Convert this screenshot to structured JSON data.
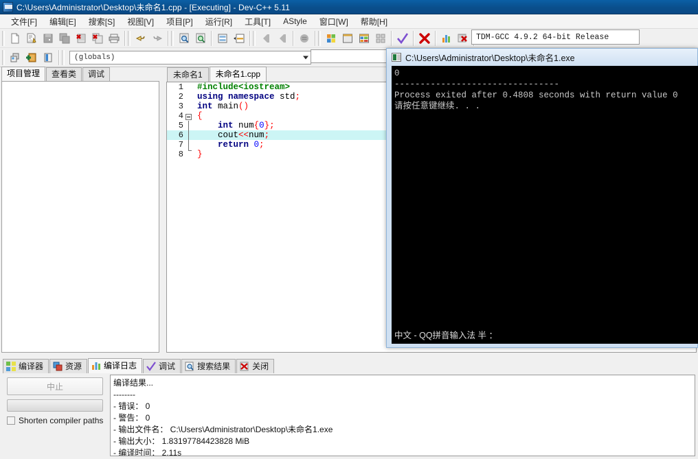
{
  "window": {
    "title": "C:\\Users\\Administrator\\Desktop\\未命名1.cpp - [Executing] - Dev-C++ 5.11",
    "icon": "devcpp-icon"
  },
  "menubar": {
    "items": [
      {
        "label": "文件[F]"
      },
      {
        "label": "编辑[E]"
      },
      {
        "label": "搜索[S]"
      },
      {
        "label": "视图[V]"
      },
      {
        "label": "项目[P]"
      },
      {
        "label": "运行[R]"
      },
      {
        "label": "工具[T]"
      },
      {
        "label": "AStyle"
      },
      {
        "label": "窗口[W]"
      },
      {
        "label": "帮助[H]"
      }
    ]
  },
  "toolbar": {
    "row1_icons": [
      "new-file-icon",
      "open-file-icon",
      "save-icon",
      "save-all-icon",
      "close-file-icon",
      "close-all-icon",
      "print-icon",
      "undo-icon",
      "redo-icon",
      "find-icon",
      "replace-icon",
      "goto-line-icon",
      "insert-icon",
      "back-icon",
      "forward-icon",
      "toggle-icon",
      "compile-icon",
      "run-icon",
      "compile-run-icon",
      "rebuild-icon",
      "debug-check-icon",
      "stop-execution-icon",
      "profile-icon",
      "delete-profile-icon"
    ],
    "row2_icons": [
      "new-project-icon",
      "add-to-project-icon",
      "remove-from-project-icon"
    ],
    "scope_combo_value": "(globals)",
    "compiler_combo_value": "TDM-GCC 4.9.2 64-bit Release"
  },
  "left_panel": {
    "tabs": [
      {
        "label": "项目管理",
        "active": true
      },
      {
        "label": "查看类",
        "active": false
      },
      {
        "label": "调试",
        "active": false
      }
    ]
  },
  "editor": {
    "tabs": [
      {
        "label": "未命名1",
        "active": false
      },
      {
        "label": "未命名1.cpp",
        "active": true
      }
    ],
    "highlighted_line": 6,
    "lines": [
      {
        "num": "1",
        "tokens": [
          {
            "t": "#include<iostream>",
            "c": "k-pre"
          }
        ]
      },
      {
        "num": "2",
        "tokens": [
          {
            "t": "using namespace ",
            "c": "k-kw"
          },
          {
            "t": "std",
            "c": "k-id"
          },
          {
            "t": ";",
            "c": "k-punc"
          }
        ]
      },
      {
        "num": "3",
        "tokens": [
          {
            "t": "int ",
            "c": "k-kw"
          },
          {
            "t": "main",
            "c": "k-id"
          },
          {
            "t": "()",
            "c": "k-punc"
          }
        ]
      },
      {
        "num": "4",
        "tokens": [
          {
            "t": "{",
            "c": "k-punc"
          }
        ]
      },
      {
        "num": "5",
        "tokens": [
          {
            "t": "    ",
            "c": "k-id"
          },
          {
            "t": "int ",
            "c": "k-kw"
          },
          {
            "t": "num",
            "c": "k-id"
          },
          {
            "t": "{",
            "c": "k-punc"
          },
          {
            "t": "0",
            "c": "k-num"
          },
          {
            "t": "};",
            "c": "k-punc"
          }
        ]
      },
      {
        "num": "6",
        "tokens": [
          {
            "t": "    ",
            "c": "k-id"
          },
          {
            "t": "cout",
            "c": "k-id"
          },
          {
            "t": "<<",
            "c": "k-punc"
          },
          {
            "t": "num",
            "c": "k-id"
          },
          {
            "t": ";",
            "c": "k-punc"
          }
        ]
      },
      {
        "num": "7",
        "tokens": [
          {
            "t": "    ",
            "c": "k-id"
          },
          {
            "t": "return ",
            "c": "k-kw"
          },
          {
            "t": "0",
            "c": "k-num"
          },
          {
            "t": ";",
            "c": "k-punc"
          }
        ]
      },
      {
        "num": "8",
        "tokens": [
          {
            "t": "}",
            "c": "k-punc"
          }
        ]
      }
    ]
  },
  "console": {
    "title": "C:\\Users\\Administrator\\Desktop\\未命名1.exe",
    "icon": "console-icon",
    "lines": [
      "0",
      "--------------------------------",
      "Process exited after 0.4808 seconds with return value 0",
      "请按任意键继续. . ."
    ],
    "ime_status": "中文 - QQ拼音输入法 半 ："
  },
  "bottom_panel": {
    "tabs": [
      {
        "label": "编译器",
        "icon": "compiler-icon",
        "active": false
      },
      {
        "label": "资源",
        "icon": "resource-icon",
        "active": false
      },
      {
        "label": "编译日志",
        "icon": "log-icon",
        "active": true
      },
      {
        "label": "调试",
        "icon": "debug-icon",
        "active": false
      },
      {
        "label": "搜索结果",
        "icon": "search-result-icon",
        "active": false
      },
      {
        "label": "关闭",
        "icon": "close-icon",
        "active": false
      }
    ],
    "abort_button": "中止",
    "shorten_checkbox_label": "Shorten compiler paths",
    "shorten_checked": false,
    "log_lines": [
      {
        "text": "编译结果...",
        "mono": false
      },
      {
        "text": "--------",
        "mono": false
      },
      {
        "text": "- 错误： 0",
        "mono": false
      },
      {
        "text": "- 警告： 0",
        "mono": false
      },
      {
        "text": "- 输出文件名： C:\\Users\\Administrator\\Desktop\\未命名1.exe",
        "mono": false
      },
      {
        "text": "- 输出大小： 1.83197784423828 MiB",
        "mono": false
      },
      {
        "text": "- 编译时间： 2.11s",
        "mono": false
      }
    ]
  },
  "colors": {
    "titlebar": "#0a4f8c",
    "accent_highlight": "#ccf5f5",
    "console_bg": "#000000",
    "panel_bg": "#f0f0f0"
  }
}
